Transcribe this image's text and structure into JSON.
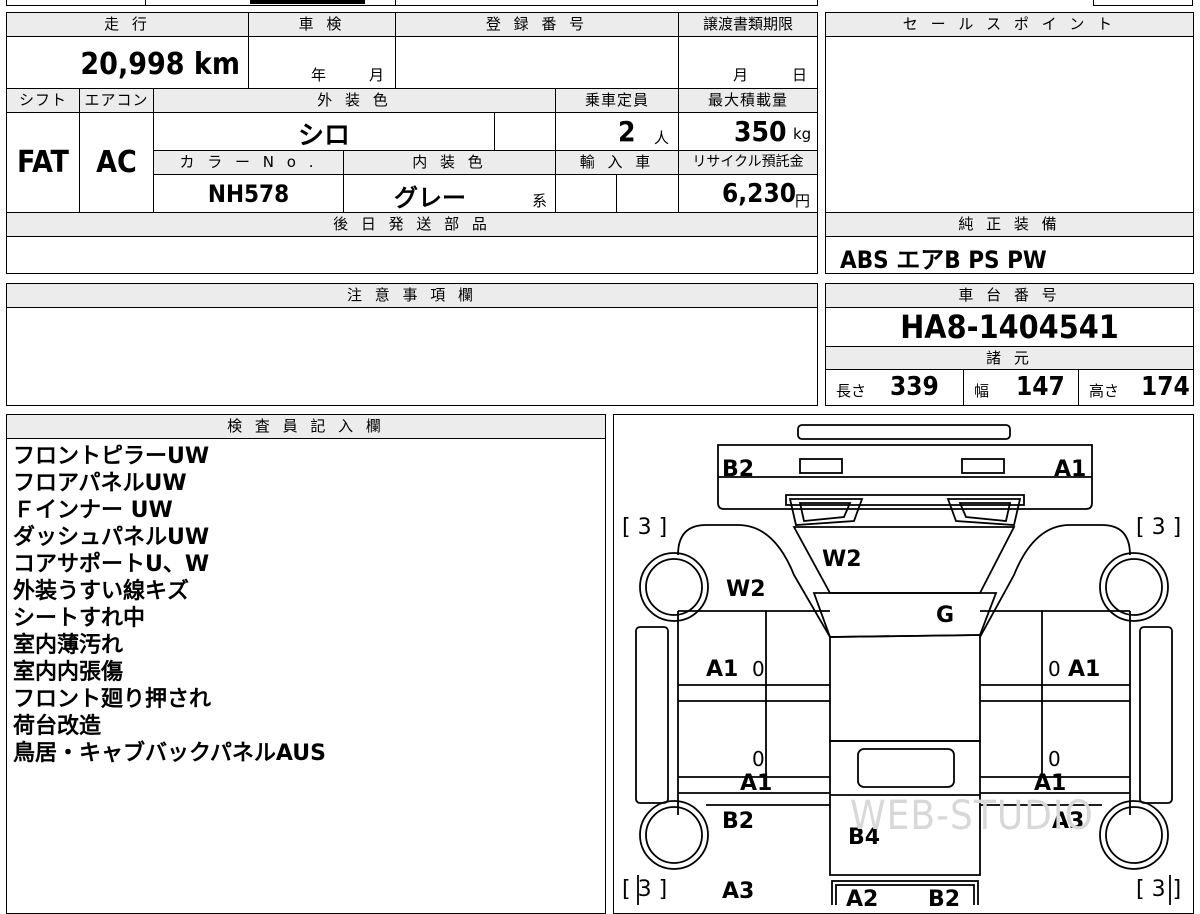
{
  "top": {
    "mileage_header": "走 行",
    "mileage_value": "20,998 km",
    "shaken_header": "車 検",
    "shaken_year": "年",
    "shaken_month": "月",
    "reg_header": "登 録 番 号",
    "transfer_header": "譲渡書類期限",
    "transfer_month": "月",
    "transfer_day": "日",
    "shift_header": "シフト",
    "shift_value": "FAT",
    "ac_header": "エアコン",
    "ac_value": "AC",
    "ext_color_header": "外 装 色",
    "ext_color_value": "シロ",
    "capacity_header": "乗車定員",
    "capacity_value": "2",
    "capacity_unit": "人",
    "maxload_header": "最大積載量",
    "maxload_value": "350",
    "maxload_unit": "kg",
    "color_no_header": "カ ラ ー N o .",
    "color_no_value": "NH578",
    "int_color_header": "内 装 色",
    "int_color_value": "グレー",
    "int_color_suffix": "系",
    "import_header": "輸 入 車",
    "recycle_header": "リサイクル預託金",
    "recycle_value": "6,230",
    "recycle_unit": "円",
    "later_parts_header": "後 日 発 送 部 品"
  },
  "sales_point": {
    "header": "セ ー ル ス ポ イ ン ト"
  },
  "equipment": {
    "header": "純 正 装 備",
    "value": "ABS エアB PS PW"
  },
  "notes": {
    "header": "注 意 事 項 欄"
  },
  "chassis": {
    "header": "車 台 番 号",
    "value": "HA8-1404541"
  },
  "specs": {
    "header": "諸 元",
    "length_label": "長さ",
    "length_value": "339",
    "width_label": "幅",
    "width_value": "147",
    "height_label": "高さ",
    "height_value": "174"
  },
  "inspector": {
    "header": "検 査 員 記 入 欄",
    "lines": [
      "フロントピラーUW",
      "フロアパネルUW",
      "Ｆインナー UW",
      "ダッシュパネルUW",
      "コアサポートU、W",
      "外装うすい線キズ",
      "シートすれ中",
      "室内薄汚れ",
      "室内内張傷",
      "フロント廻り押され",
      "荷台改造",
      "鳥居・キャブバックパネルAUS"
    ]
  },
  "diagram": {
    "bracket_3": "[ 3 ]",
    "labels": {
      "b2_top": "B2",
      "a1_top": "A1",
      "w2_windshield": "W2",
      "w2_pillar": "W2",
      "g": "G",
      "a1_left_door": "A1",
      "a1_right_door": "A1",
      "zero_1": "0",
      "zero_2": "0",
      "zero_3": "0",
      "zero_4": "0",
      "a1_left_sill": "A1",
      "a1_right_sill": "A1",
      "b2_rear": "B2",
      "a3_right": "A3",
      "b4_bed": "B4",
      "a3_bottom_left": "A3",
      "a2_bottom": "A2",
      "b2_bottom": "B2"
    },
    "watermark": "WEB-STUDIO"
  }
}
